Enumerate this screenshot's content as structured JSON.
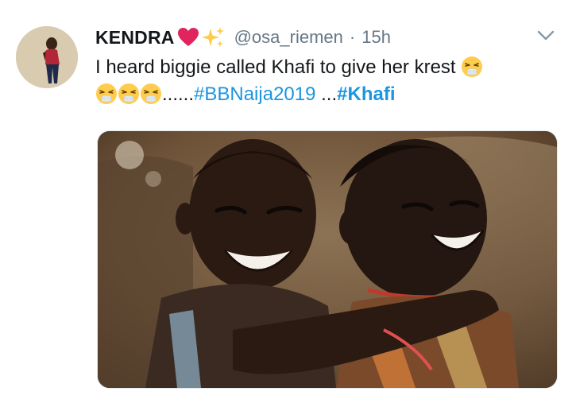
{
  "tweet": {
    "display_name": "KENDRA",
    "name_emojis": [
      "heart-icon",
      "sparkles-icon"
    ],
    "handle": "@osa_riemen",
    "separator": "·",
    "time": "15h",
    "text_line1": "I heard biggie called Khafi to give her krest",
    "text_ellipsis": "......",
    "hashtag1": "#BBNaija2019",
    "text_between": " ...",
    "hashtag2": "#Khafi",
    "emojis": [
      "sneezing-face-icon",
      "sneezing-face-icon",
      "sneezing-face-icon",
      "sneezing-face-icon"
    ],
    "media_description_icon": "photo-two-laughing-children"
  },
  "colors": {
    "link": "#1b95e0",
    "secondary_text": "#657786",
    "primary_text": "#14171a",
    "heart": "#e0245e",
    "sparkle": "#ffcc4d"
  }
}
